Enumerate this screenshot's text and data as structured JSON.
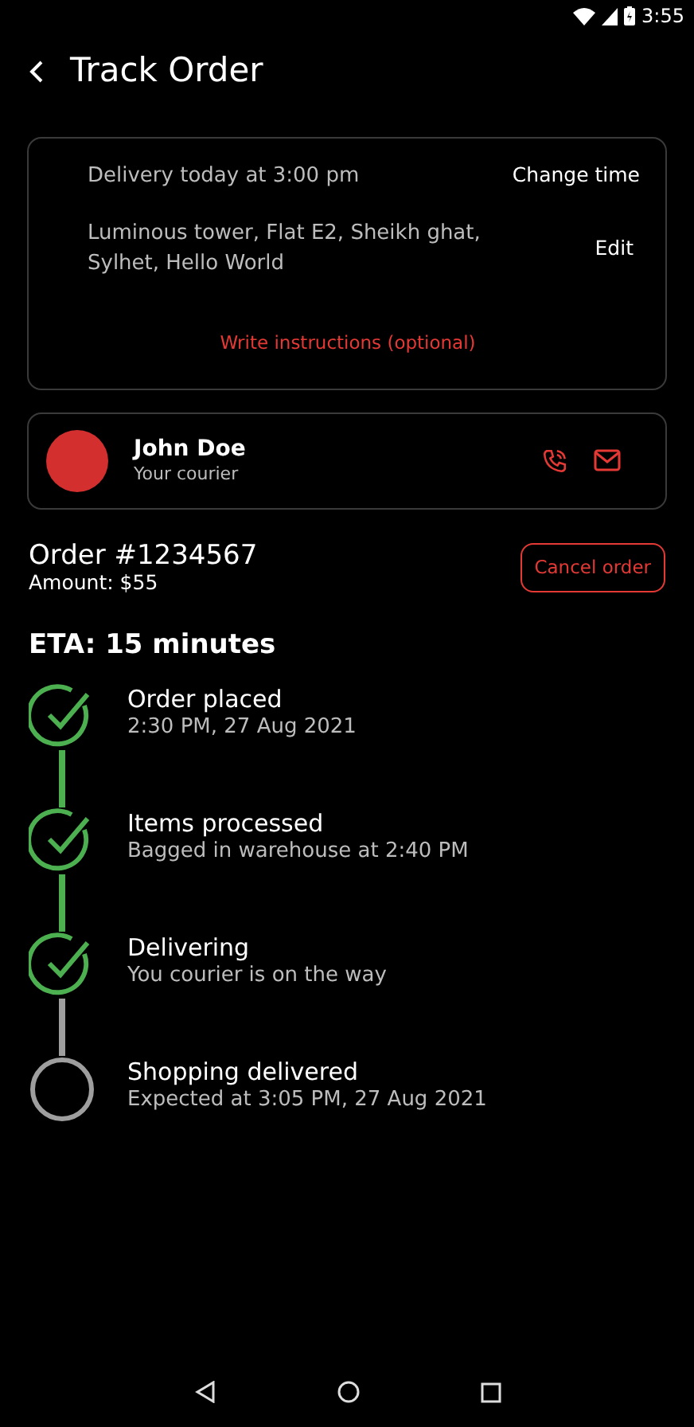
{
  "status_bar": {
    "time": "3:55"
  },
  "header": {
    "title": "Track Order"
  },
  "delivery": {
    "time_text": "Delivery today at 3:00 pm",
    "change_time": "Change time",
    "address": "Luminous tower, Flat E2, Sheikh ghat, Sylhet, Hello World",
    "edit": "Edit",
    "instructions": "Write instructions (optional)"
  },
  "courier": {
    "name": "John Doe",
    "role": "Your courier"
  },
  "order": {
    "number": "Order #1234567",
    "amount": "Amount: $55",
    "cancel": "Cancel order"
  },
  "eta": "ETA: 15 minutes",
  "steps": [
    {
      "title": "Order placed",
      "detail": "2:30 PM, 27 Aug 2021",
      "done": true
    },
    {
      "title": "Items processed",
      "detail": "Bagged in warehouse at 2:40 PM",
      "done": true
    },
    {
      "title": "Delivering",
      "detail": "You courier is on the way",
      "done": true
    },
    {
      "title": "Shopping delivered",
      "detail": "Expected at 3:05 PM, 27 Aug 2021",
      "done": false
    }
  ]
}
